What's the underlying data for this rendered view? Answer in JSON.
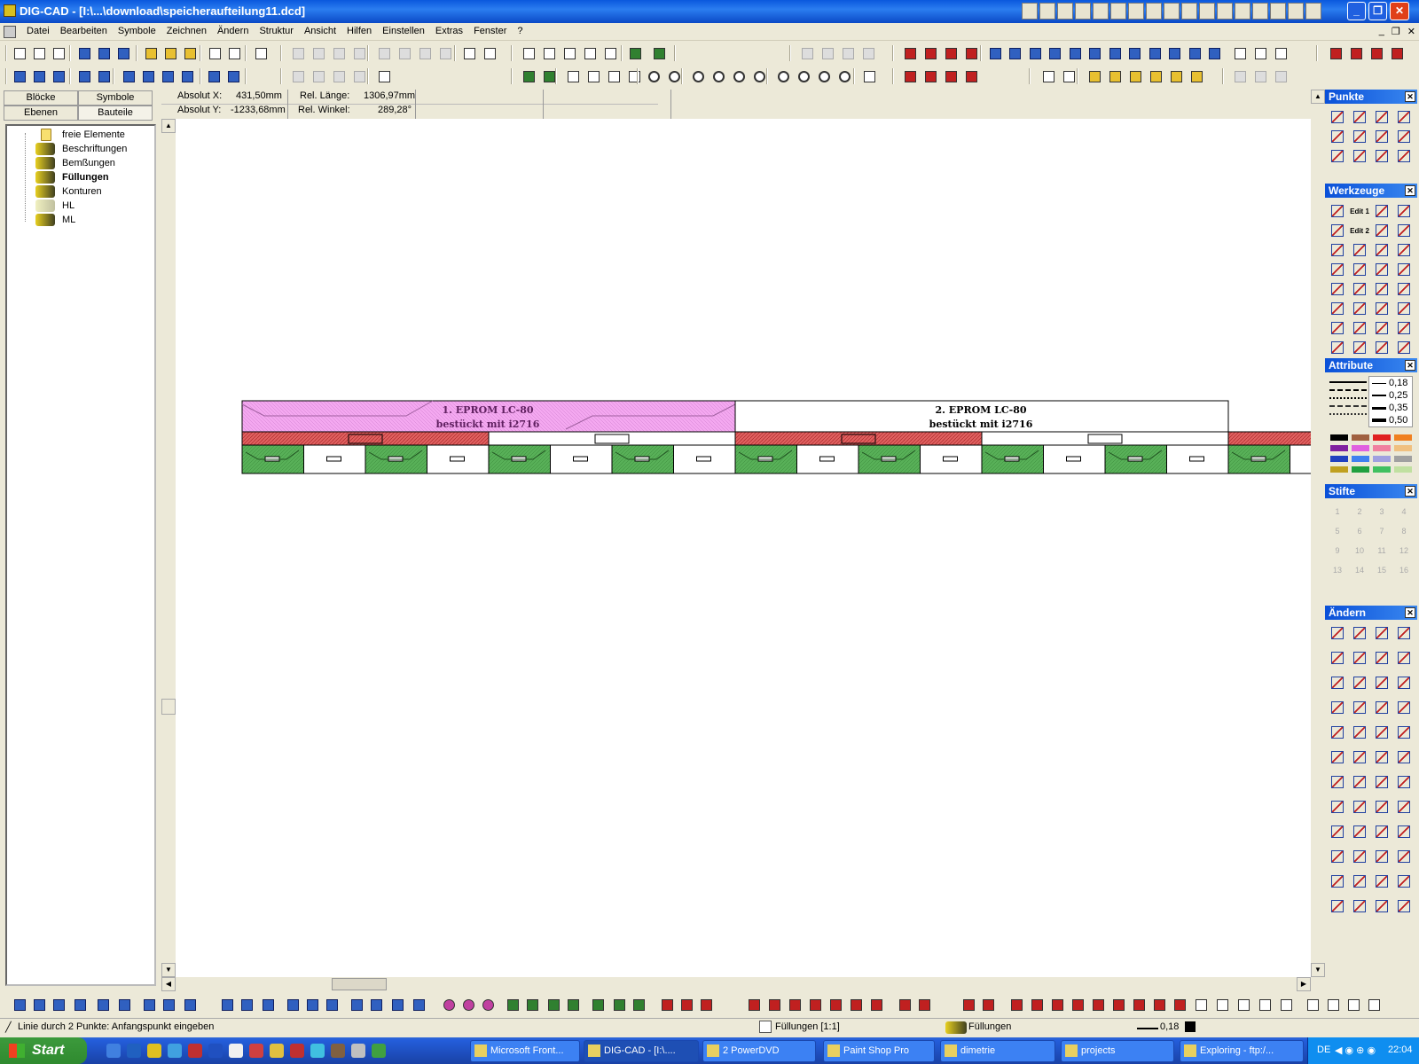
{
  "window": {
    "title": "DIG-CAD - [I:\\...\\download\\speicheraufteilung11.dcd]"
  },
  "menu": {
    "items": [
      "Datei",
      "Bearbeiten",
      "Symbole",
      "Zeichnen",
      "Ändern",
      "Struktur",
      "Ansicht",
      "Hilfen",
      "Einstellen",
      "Extras",
      "Fenster",
      "?"
    ]
  },
  "left_tabs": {
    "bloecke": "Blöcke",
    "symbole": "Symbole",
    "ebenen": "Ebenen",
    "bauteile": "Bauteile"
  },
  "tree": {
    "items": [
      {
        "label": "freie Elemente",
        "icon": "folder-icon",
        "bold": false,
        "faded": false
      },
      {
        "label": "Beschriftungen",
        "icon": "component-icon",
        "bold": false,
        "faded": false
      },
      {
        "label": "Bemßungen",
        "icon": "component-icon",
        "bold": false,
        "faded": false
      },
      {
        "label": "Füllungen",
        "icon": "component-icon",
        "bold": true,
        "faded": false
      },
      {
        "label": "Konturen",
        "icon": "component-icon",
        "bold": false,
        "faded": false
      },
      {
        "label": "HL",
        "icon": "component-icon",
        "bold": false,
        "faded": true
      },
      {
        "label": "ML",
        "icon": "component-icon",
        "bold": false,
        "faded": false
      }
    ]
  },
  "coords": {
    "absolut_x_label": "Absolut X:",
    "absolut_x": "431,50mm",
    "absolut_y_label": "Absolut Y:",
    "absolut_y": "-1233,68mm",
    "rel_laenge_label": "Rel. Länge:",
    "rel_laenge": "1306,97mm",
    "rel_winkel_label": "Rel. Winkel:",
    "rel_winkel": "289,28°"
  },
  "drawing": {
    "block1_line1": "1. EPROM LC-80",
    "block1_line2": "bestückt mit i2716",
    "block2_line1": "2. EPROM LC-80",
    "block2_line2": "bestückt mit i2716"
  },
  "panels": {
    "punkte": "Punkte",
    "werkzeuge": "Werkzeuge",
    "attribute": "Attribute",
    "stifte": "Stifte",
    "aendern": "Ändern"
  },
  "attribute_widths": [
    "0,18",
    "0,25",
    "0,35",
    "0,50"
  ],
  "werkzeuge_edit": [
    "Edit 1",
    "Edit 2"
  ],
  "stifte_labels": [
    "1",
    "2",
    "3",
    "4",
    "5",
    "6",
    "7",
    "8",
    "9",
    "10",
    "11",
    "12",
    "13",
    "14",
    "15",
    "16"
  ],
  "colors": {
    "accent": "#0a50d8",
    "fill_green": "#4caf50",
    "fill_red": "#e05050",
    "fill_pink": "#f0a0f0"
  },
  "status": {
    "hint": "Linie durch 2 Punkte: Anfangspunkt eingeben",
    "layer": "Füllungen [1:1]",
    "component": "Füllungen",
    "linewidth": "0,18"
  },
  "taskbar": {
    "start": "Start",
    "tasks": [
      "Microsoft Front...",
      "DIG-CAD - [I:\\....",
      "2 PowerDVD",
      "Paint Shop Pro",
      "dimetrie",
      "projects",
      "Exploring - ftp:/..."
    ],
    "lang": "DE",
    "time": "22:04"
  }
}
